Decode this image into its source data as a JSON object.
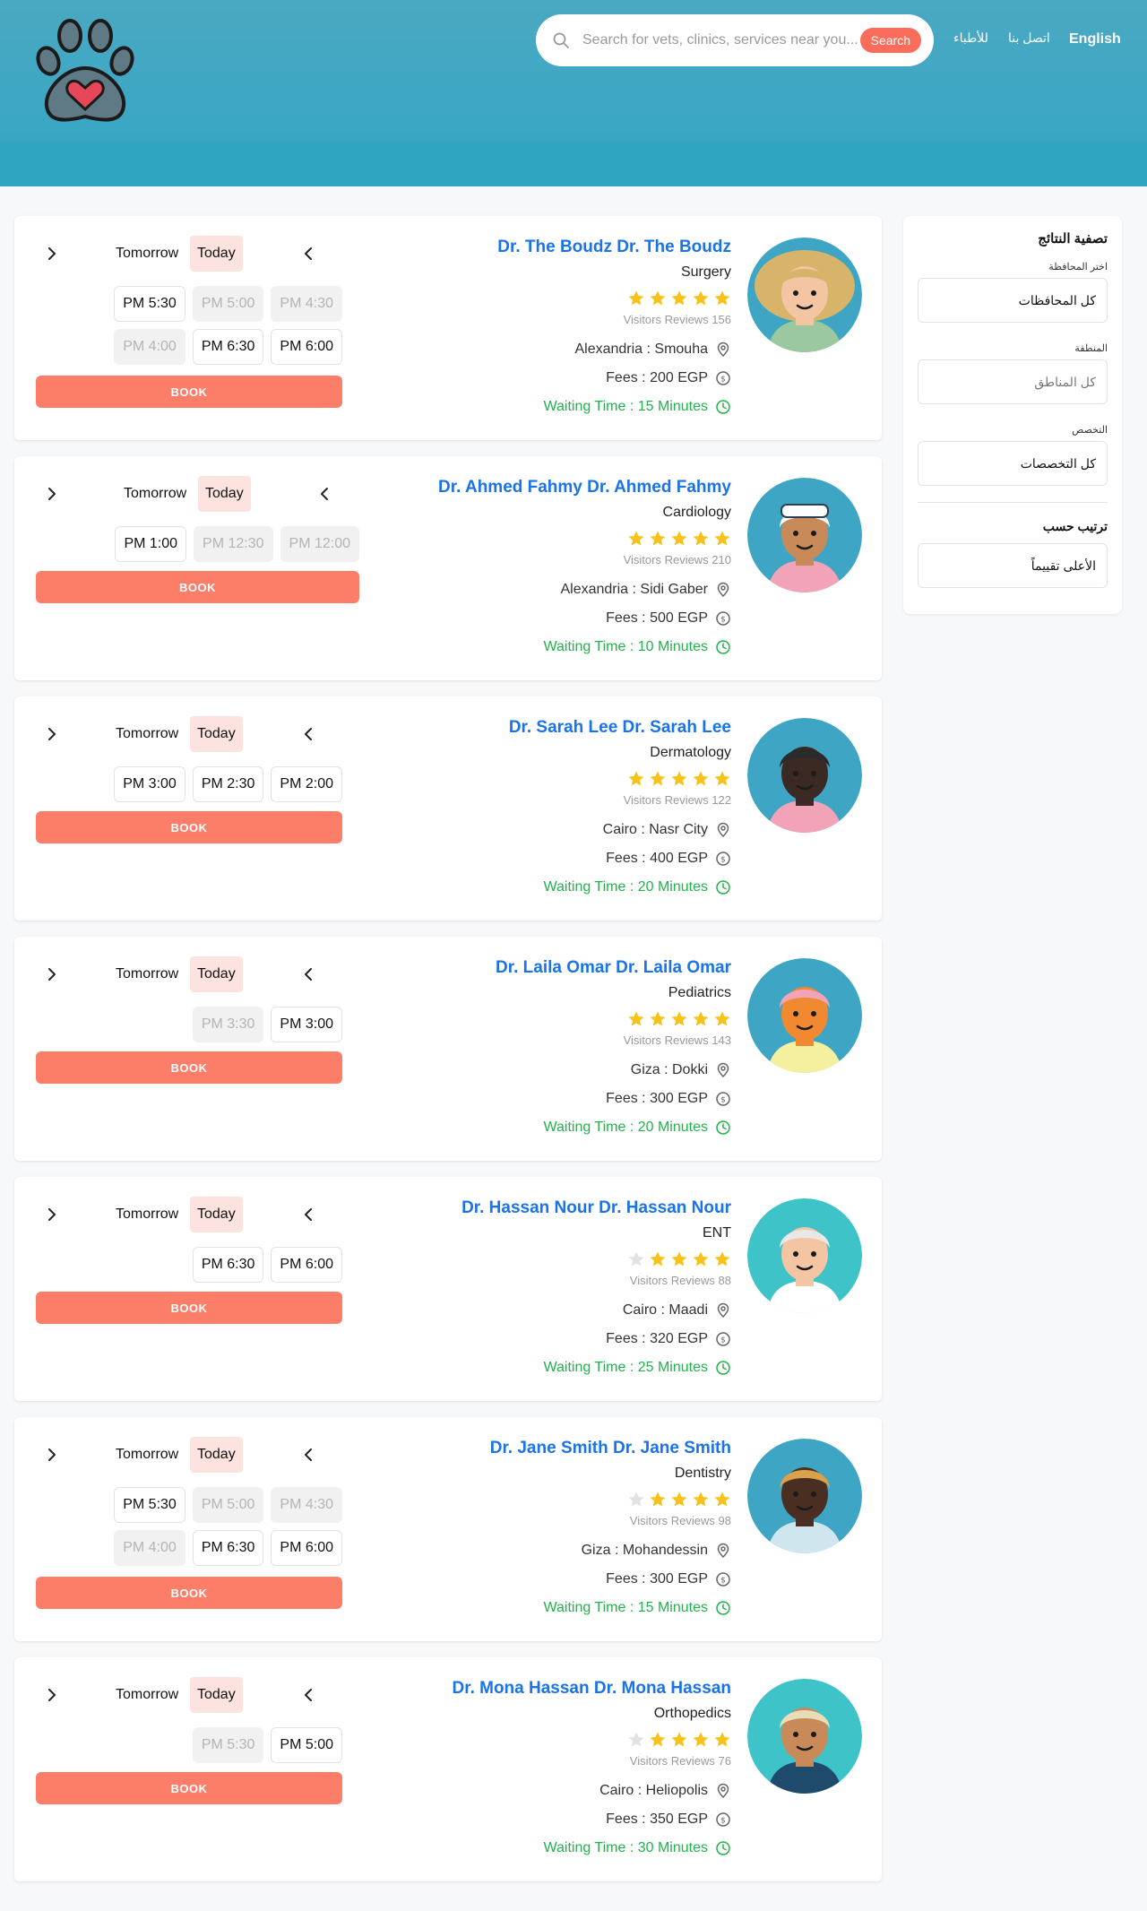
{
  "header": {
    "search_placeholder": "Search for vets, clinics, services near you...",
    "search_button": "Search",
    "nav": {
      "doctors": "للأطباء",
      "contact": "اتصل بنا",
      "language": "English"
    }
  },
  "filter": {
    "title": "تصفية النتائج",
    "governorate_label": "اختر المحافظة",
    "governorate_value": "كل المحافظات",
    "area_label": "المنطقة",
    "area_value": "كل المناطق",
    "specialty_label": "التخصص",
    "specialty_value": "كل التخصصات",
    "sort_label": "ترتيب حسب",
    "sort_value": "الأعلى تقييماً"
  },
  "doctors": [
    {
      "name": "Dr. The Boudz Dr. The Boudz",
      "specialty": "Surgery",
      "rating": 5,
      "reviews": "Visitors Reviews 156",
      "location": "Alexandria : Smouha",
      "fees": "Fees : 200 EGP",
      "waiting": "Waiting Time : 15 Minutes",
      "tomorrow": "Tomorrow",
      "today": "Today",
      "slots": [
        {
          "t": "PM 5:30",
          "on": true
        },
        {
          "t": "PM 5:00",
          "on": false
        },
        {
          "t": "PM 4:30",
          "on": false
        },
        {
          "t": "PM 4:00",
          "on": false
        },
        {
          "t": "PM 6:30",
          "on": true
        },
        {
          "t": "PM 6:00",
          "on": true
        }
      ],
      "book": "BOOK"
    },
    {
      "name": "Dr. Ahmed Fahmy Dr. Ahmed Fahmy",
      "specialty": "Cardiology",
      "rating": 5,
      "reviews": "Visitors Reviews 210",
      "location": "Alexandria : Sidi Gaber",
      "fees": "Fees : 500 EGP",
      "waiting": "Waiting Time : 10 Minutes",
      "tomorrow": "Tomorrow",
      "today": "Today",
      "slots": [
        {
          "t": "PM 1:00",
          "on": true
        },
        {
          "t": "PM 12:30",
          "on": false
        },
        {
          "t": "PM 12:00",
          "on": false
        }
      ],
      "book": "BOOK"
    },
    {
      "name": "Dr. Sarah Lee Dr. Sarah Lee",
      "specialty": "Dermatology",
      "rating": 5,
      "reviews": "Visitors Reviews 122",
      "location": "Cairo : Nasr City",
      "fees": "Fees : 400 EGP",
      "waiting": "Waiting Time : 20 Minutes",
      "tomorrow": "Tomorrow",
      "today": "Today",
      "slots": [
        {
          "t": "PM 3:00",
          "on": true
        },
        {
          "t": "PM 2:30",
          "on": true
        },
        {
          "t": "PM 2:00",
          "on": true
        }
      ],
      "book": "BOOK"
    },
    {
      "name": "Dr. Laila Omar Dr. Laila Omar",
      "specialty": "Pediatrics",
      "rating": 5,
      "reviews": "Visitors Reviews 143",
      "location": "Giza : Dokki",
      "fees": "Fees : 300 EGP",
      "waiting": "Waiting Time : 20 Minutes",
      "tomorrow": "Tomorrow",
      "today": "Today",
      "slots": [
        {
          "t": "PM 3:30",
          "on": false
        },
        {
          "t": "PM 3:00",
          "on": true
        }
      ],
      "book": "BOOK"
    },
    {
      "name": "Dr. Hassan Nour Dr. Hassan Nour",
      "specialty": "ENT",
      "rating": 4,
      "reviews": "Visitors Reviews 88",
      "location": "Cairo : Maadi",
      "fees": "Fees : 320 EGP",
      "waiting": "Waiting Time : 25 Minutes",
      "tomorrow": "Tomorrow",
      "today": "Today",
      "slots": [
        {
          "t": "PM 6:30",
          "on": true
        },
        {
          "t": "PM 6:00",
          "on": true
        }
      ],
      "book": "BOOK"
    },
    {
      "name": "Dr. Jane Smith Dr. Jane Smith",
      "specialty": "Dentistry",
      "rating": 4,
      "reviews": "Visitors Reviews 98",
      "location": "Giza : Mohandessin",
      "fees": "Fees : 300 EGP",
      "waiting": "Waiting Time : 15 Minutes",
      "tomorrow": "Tomorrow",
      "today": "Today",
      "slots": [
        {
          "t": "PM 5:30",
          "on": true
        },
        {
          "t": "PM 5:00",
          "on": false
        },
        {
          "t": "PM 4:30",
          "on": false
        },
        {
          "t": "PM 4:00",
          "on": false
        },
        {
          "t": "PM 6:30",
          "on": true
        },
        {
          "t": "PM 6:00",
          "on": true
        }
      ],
      "book": "BOOK"
    },
    {
      "name": "Dr. Mona Hassan Dr. Mona Hassan",
      "specialty": "Orthopedics",
      "rating": 4,
      "reviews": "Visitors Reviews 76",
      "location": "Cairo : Heliopolis",
      "fees": "Fees : 350 EGP",
      "waiting": "Waiting Time : 30 Minutes",
      "tomorrow": "Tomorrow",
      "today": "Today",
      "slots": [
        {
          "t": "PM 5:30",
          "on": false
        },
        {
          "t": "PM 5:00",
          "on": true
        }
      ],
      "book": "BOOK"
    }
  ],
  "colors": {
    "brand": "#3aa7c4",
    "accent": "#fc7e69",
    "link": "#1a73e8",
    "success": "#22b24c",
    "star": "#f6c21c"
  }
}
